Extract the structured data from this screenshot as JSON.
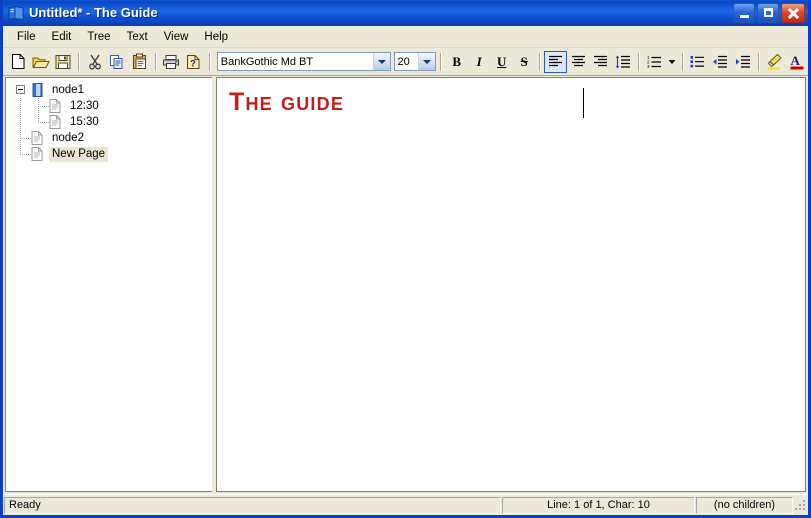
{
  "window": {
    "title": "Untitled* - The Guide",
    "icon": "book-icon",
    "controls": {
      "minimize": "Minimize",
      "maximize": "Maximize",
      "close": "Close"
    }
  },
  "menu": {
    "items": [
      {
        "label": "File"
      },
      {
        "label": "Edit"
      },
      {
        "label": "Tree"
      },
      {
        "label": "Text"
      },
      {
        "label": "View"
      },
      {
        "label": "Help"
      }
    ]
  },
  "toolbar": {
    "buttons": [
      {
        "name": "new-file-icon",
        "title": "New"
      },
      {
        "name": "open-folder-icon",
        "title": "Open"
      },
      {
        "name": "save-icon",
        "title": "Save"
      },
      {
        "name": "cut-icon",
        "title": "Cut"
      },
      {
        "name": "copy-icon",
        "title": "Copy"
      },
      {
        "name": "paste-icon",
        "title": "Paste"
      },
      {
        "name": "print-icon",
        "title": "Print"
      },
      {
        "name": "help-icon",
        "title": "Help"
      }
    ],
    "font": {
      "value": "BankGothic Md BT",
      "placeholder": "BankGothic Md BT"
    },
    "size": {
      "value": "20",
      "placeholder": "20"
    },
    "format": [
      {
        "name": "bold-icon",
        "label": "B"
      },
      {
        "name": "italic-icon",
        "label": "I"
      },
      {
        "name": "underline-icon",
        "label": "U"
      },
      {
        "name": "strikethrough-icon",
        "label": "S"
      }
    ],
    "align": [
      {
        "name": "align-left-icon",
        "active": true
      },
      {
        "name": "align-center-icon",
        "active": false
      },
      {
        "name": "align-right-icon",
        "active": false
      },
      {
        "name": "line-spacing-icon",
        "active": false
      }
    ],
    "lists": [
      {
        "name": "numbered-list-icon"
      },
      {
        "name": "numbered-list-dropdown-icon"
      },
      {
        "name": "bullet-list-icon"
      },
      {
        "name": "decrease-indent-icon"
      },
      {
        "name": "increase-indent-icon"
      }
    ],
    "colors": [
      {
        "name": "highlight-color-icon",
        "color": "#ffe400"
      },
      {
        "name": "font-color-icon",
        "color": "#cc0000"
      }
    ]
  },
  "tree": {
    "nodes": [
      {
        "label": "node1",
        "icon": "book-icon",
        "level": 0,
        "expanded": true,
        "selected": false
      },
      {
        "label": "12:30",
        "icon": "page-icon",
        "level": 1,
        "expanded": false,
        "selected": false
      },
      {
        "label": "15:30",
        "icon": "page-icon",
        "level": 1,
        "expanded": false,
        "selected": false
      },
      {
        "label": "node2",
        "icon": "page-icon",
        "level": 0,
        "expanded": false,
        "selected": false
      },
      {
        "label": "New Page",
        "icon": "page-icon",
        "level": 0,
        "expanded": false,
        "selected": true
      }
    ]
  },
  "editor": {
    "text": "The guide",
    "text_color": "#c0201c",
    "font_size": "20"
  },
  "status": {
    "message": "Ready",
    "position": "Line: 1 of 1, Char: 10",
    "children": "(no children)"
  }
}
